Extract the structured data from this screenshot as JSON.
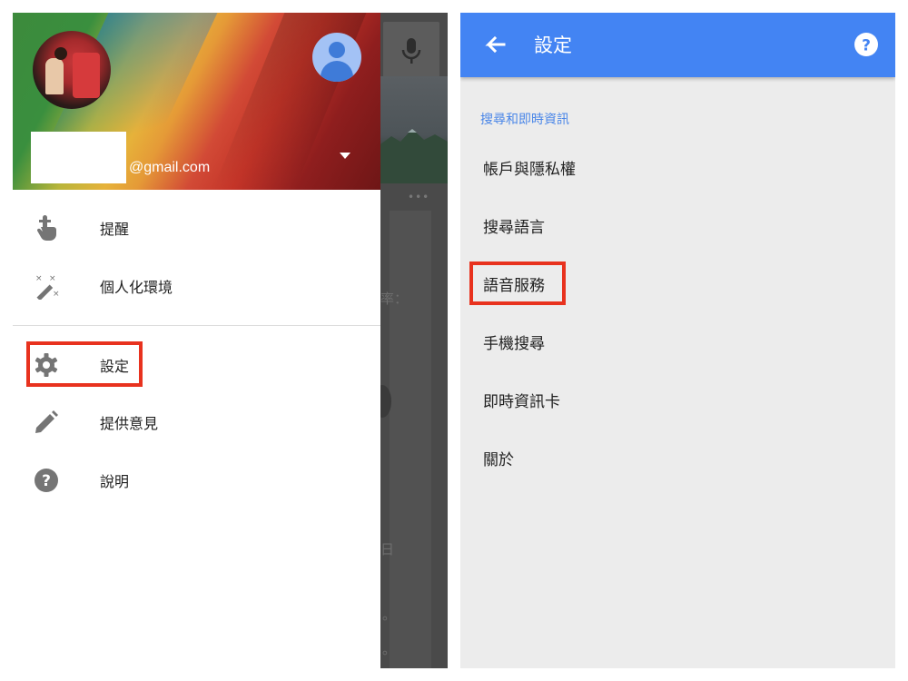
{
  "drawer": {
    "email_suffix": "@gmail.com",
    "items": [
      {
        "label": "提醒",
        "icon": "reminder-finger-icon"
      },
      {
        "label": "個人化環境",
        "icon": "magic-wand-icon"
      },
      {
        "label": "設定",
        "icon": "gear-icon"
      },
      {
        "label": "提供意見",
        "icon": "pencil-icon"
      },
      {
        "label": "說明",
        "icon": "help-icon"
      }
    ]
  },
  "background_app": {
    "ghost_texts": [
      "率：",
      "日",
      "。",
      "。"
    ]
  },
  "settings": {
    "title": "設定",
    "section_header": "搜尋和即時資訊",
    "items": [
      {
        "label": "帳戶與隱私權"
      },
      {
        "label": "搜尋語言"
      },
      {
        "label": "語音服務"
      },
      {
        "label": "手機搜尋"
      },
      {
        "label": "即時資訊卡"
      },
      {
        "label": "關於"
      }
    ]
  },
  "colors": {
    "header_blue": "#4384f3",
    "section_blue": "#4a86e8",
    "highlight_red": "#e8321e",
    "icon_gray": "#757575"
  }
}
